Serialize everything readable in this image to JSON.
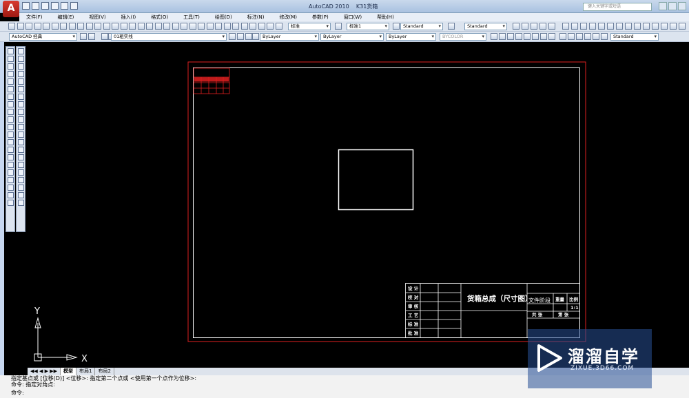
{
  "window": {
    "title": "AutoCAD 2010",
    "document": "K31货箱",
    "search_placeholder": "键入关键字或短语"
  },
  "menu": [
    "文件(F)",
    "编辑(E)",
    "视图(V)",
    "插入(I)",
    "格式(O)",
    "工具(T)",
    "绘图(D)",
    "标注(N)",
    "修改(M)",
    "参数(P)",
    "窗口(W)",
    "帮助(H)"
  ],
  "toolbar1": {
    "text_style": "标准",
    "dim_style": "标准1",
    "table_style": "Standard",
    "multileader_style": "Standard"
  },
  "toolbar2": {
    "workspace": "AutoCAD 经典",
    "layer": "01粗实线",
    "color": "ByLayer",
    "linetype": "ByLayer",
    "lineweight": "ByLayer",
    "plotstyle": "BYCOLOR",
    "visual_style": "Standard"
  },
  "drawing": {
    "title_block": {
      "row_labels": [
        "设 计",
        "校 对",
        "审 核",
        "工 艺",
        "标 准",
        "批 准"
      ],
      "part_name": "货箱总成（尺寸图）",
      "doc_stage": "文件阶段",
      "weight_label": "重量",
      "scale_label": "比例",
      "scale_value": "1:1",
      "sheets_total": "共  张",
      "sheet_no": "第  张"
    }
  },
  "ucs": {
    "x_label": "X",
    "y_label": "Y"
  },
  "tabs": [
    "模型",
    "布局1",
    "布局2"
  ],
  "command_lines": [
    "指定基点或 [位移(D)] <位移>:  指定第二个点或 <使用第一个点作为位移>:",
    "命令: 指定对角点:",
    "命令:"
  ],
  "watermark": {
    "main": "溜溜自学",
    "sub": "ZIXUE.3D66.COM"
  }
}
